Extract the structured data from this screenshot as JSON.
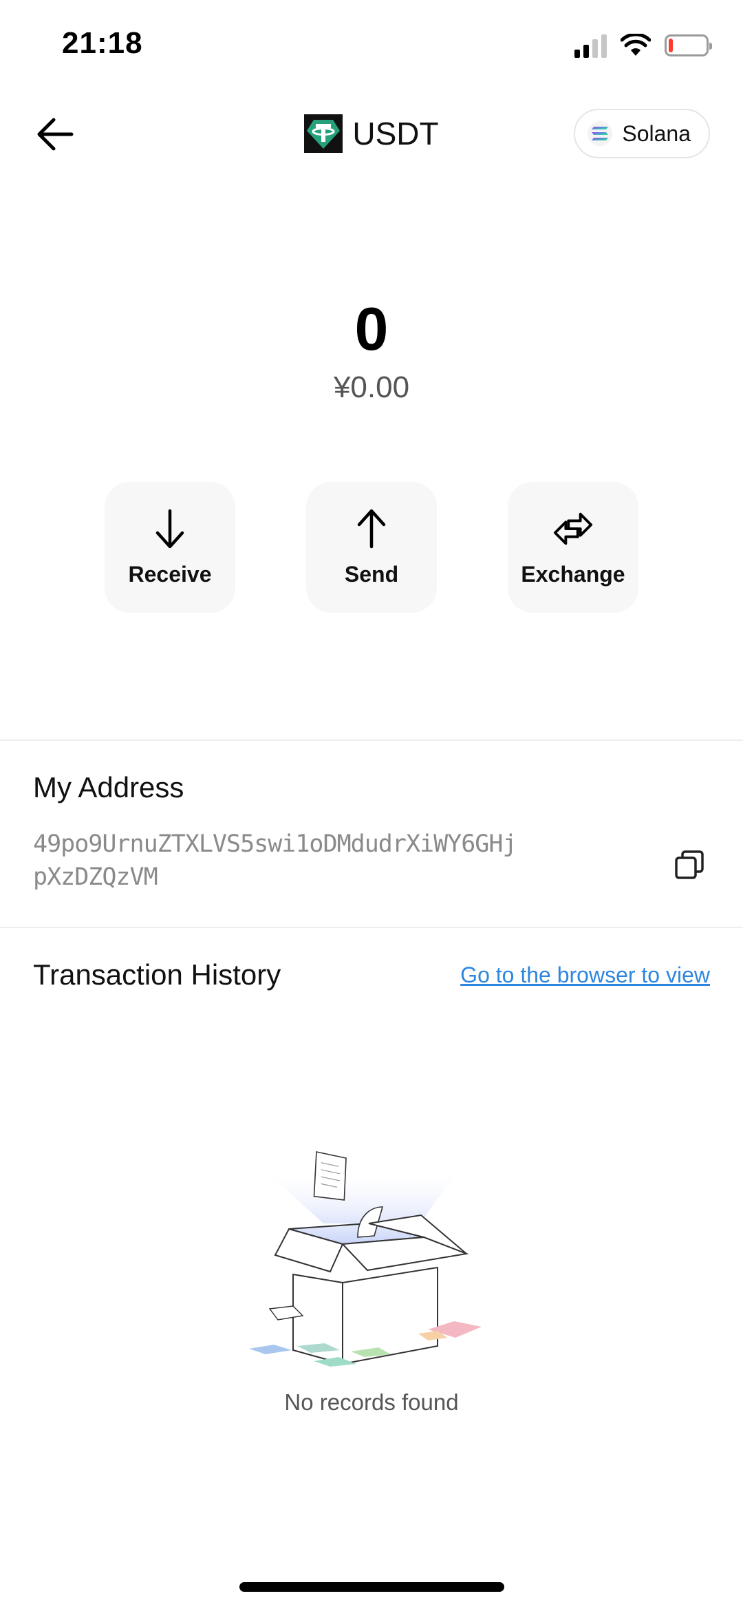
{
  "status_bar": {
    "time": "21:18",
    "icons": [
      "signal-icon",
      "wifi-icon",
      "battery-icon"
    ],
    "battery_level": 0.12
  },
  "header": {
    "back_icon": "arrow-left-icon",
    "token_logo": "tether-icon",
    "title": "USDT",
    "network": {
      "icon": "solana-icon",
      "label": "Solana"
    }
  },
  "balance": {
    "amount": "0",
    "fiat": "¥0.00"
  },
  "actions": [
    {
      "label": "Receive",
      "icon": "arrow-down-icon"
    },
    {
      "label": "Send",
      "icon": "arrow-up-icon"
    },
    {
      "label": "Exchange",
      "icon": "swap-icon"
    }
  ],
  "address": {
    "title": "My Address",
    "value": "49po9UrnuZTXLVS5swi1oDMdudrXiWY6GHjpXzDZQzVM",
    "copy_icon": "copy-icon"
  },
  "history": {
    "title": "Transaction History",
    "link": "Go to the browser to view ",
    "empty_text": "No records found",
    "empty_icon": "empty-box-icon"
  },
  "colors": {
    "link": "#2e86de",
    "tether": "#26a17b",
    "battery_low": "#ff3b30",
    "button_bg": "#f7f7f7"
  }
}
